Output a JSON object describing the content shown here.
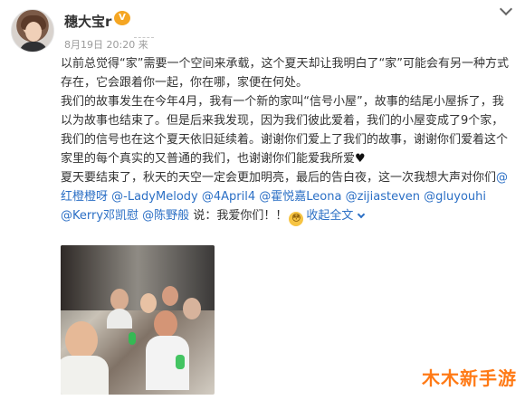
{
  "user": {
    "name": "穗大宝r",
    "badge": "V",
    "timestamp": "8月19日 20:20 来"
  },
  "post": {
    "paragraph1": "以前总觉得“家”需要一个空间来承载，这个夏天却让我明白了“家”可能会有另一种方式存在，它会跟着你一起，你在哪，家便在何处。",
    "paragraph2_text": "我们的故事发生在今年4月，我有一个新的家叫“信号小屋”，故事的结尾小屋拆了，我以为故事也结束了。但是后来我发现，因为我们彼此爱着，我们的小屋变成了9个家，我们的信号也在这个夏天依旧延续着。谢谢你们爱上了我们的故事，谢谢你们爱着这个家里的每个真实的又普通的我们，也谢谢你们能爱我所爱",
    "heart": "♥",
    "paragraph3_text": "夏天要结束了，秋天的天空一定会更加明亮，最后的告白夜，这一次我想大声对你们",
    "mentions": [
      "@红橙橙呀",
      "@-LadyMelody",
      "@4April4",
      "@霍悦嘉Leona",
      "@zijiasteven",
      "@gluyouhi",
      "@Kerry邓凯慰",
      "@陈野般"
    ],
    "paragraph3_end": "说：我爱你们！！",
    "emoji": "😳",
    "expand": "收起全文"
  },
  "watermark": "木木新手游",
  "colors": {
    "link": "#2b6fc5",
    "watermark": "#ff7a16"
  }
}
